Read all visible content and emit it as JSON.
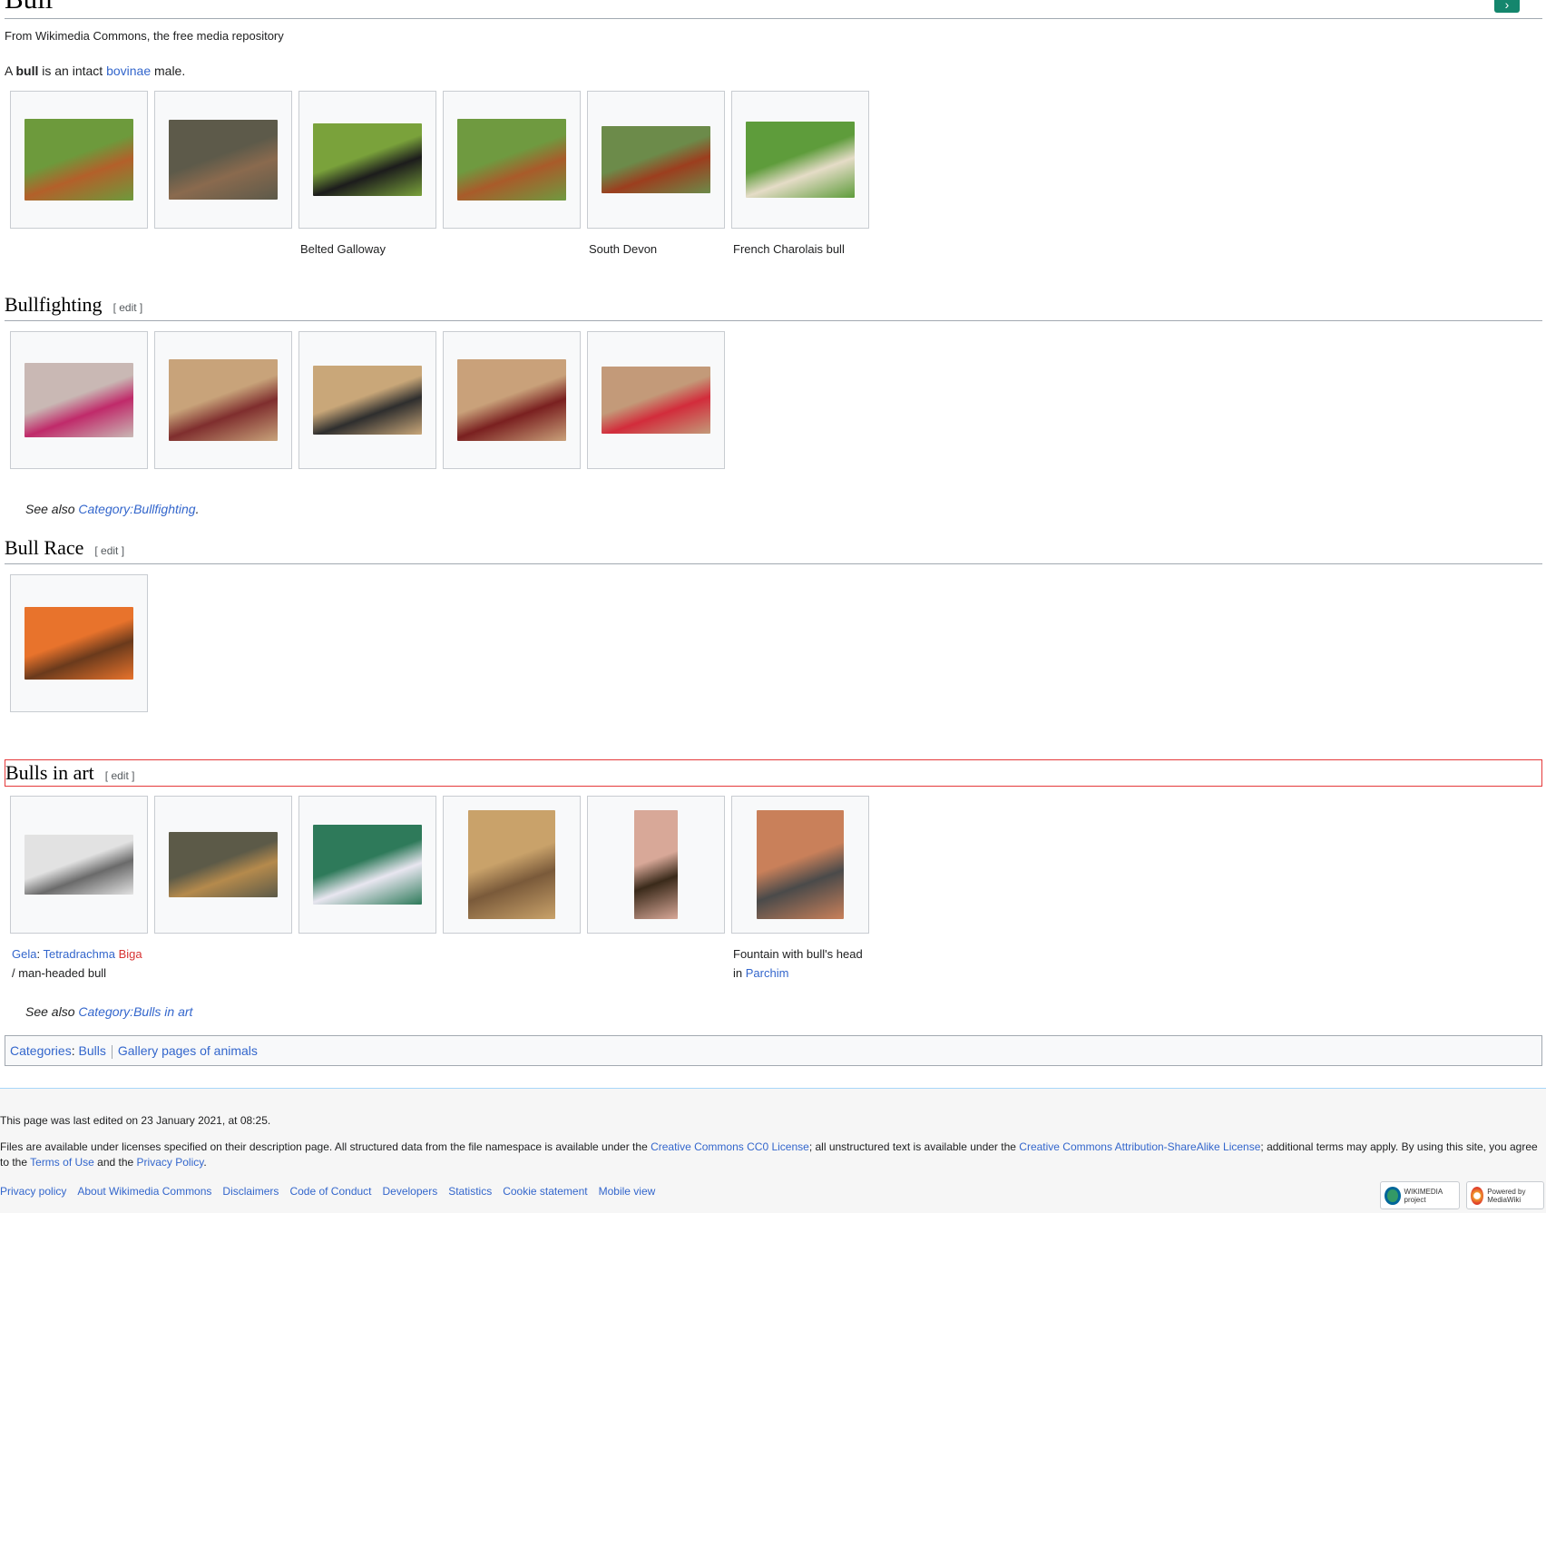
{
  "page": {
    "title": "Bull",
    "site_sub": "From Wikimedia Commons, the free media repository",
    "intro": {
      "prefix": "A ",
      "bold": "bull",
      "middle": " is an intact ",
      "link": "bovinae",
      "suffix": " male."
    }
  },
  "sections": {
    "main": {
      "images": [
        {
          "caption": "",
          "colors": [
            "#6d9a3c",
            "#b3602a"
          ]
        },
        {
          "caption": "",
          "colors": [
            "#5d5a4a",
            "#8a6a4e"
          ]
        },
        {
          "caption": "Belted Galloway",
          "colors": [
            "#7aa23b",
            "#1c1c1c"
          ]
        },
        {
          "caption": "",
          "colors": [
            "#6f9a40",
            "#a95b2a"
          ]
        },
        {
          "caption": "South Devon",
          "colors": [
            "#6c8b4a",
            "#9c3e1e"
          ]
        },
        {
          "caption": "French Charolais bull",
          "colors": [
            "#5e9c3b",
            "#e5dcc7"
          ]
        }
      ]
    },
    "bullfighting": {
      "heading": "Bullfighting",
      "edit": "[ edit ]",
      "images": [
        {
          "colors": [
            "#c9b8b4",
            "#c02a6a"
          ]
        },
        {
          "colors": [
            "#c8a37a",
            "#7f2e2e"
          ]
        },
        {
          "colors": [
            "#c9a779",
            "#2e2e2e"
          ]
        },
        {
          "colors": [
            "#c9a17a",
            "#7a2020"
          ]
        },
        {
          "colors": [
            "#c39a79",
            "#d22c3b"
          ]
        }
      ],
      "see_also_prefix": "See also ",
      "see_also_link": "Category:Bullfighting",
      "see_also_suffix": "."
    },
    "bull_race": {
      "heading": "Bull Race",
      "edit": "[ edit ]",
      "images": [
        {
          "colors": [
            "#e8732c",
            "#6a3a1c"
          ]
        }
      ]
    },
    "bulls_in_art": {
      "heading": "Bulls in art",
      "edit": "[ edit ]",
      "images": [
        {
          "colors": [
            "#e2e2e2",
            "#6a6a6a"
          ]
        },
        {
          "colors": [
            "#5c5a48",
            "#b58a4c"
          ]
        },
        {
          "colors": [
            "#2e7a5a",
            "#e8e6f0"
          ]
        },
        {
          "colors": [
            "#c9a26a",
            "#7a5a3a"
          ]
        },
        {
          "colors": [
            "#d8a898",
            "#3a2a1a"
          ]
        },
        {
          "colors": [
            "#c9805a",
            "#4a4a4a"
          ]
        }
      ],
      "caption1": {
        "link1": "Gela",
        "sep": ": ",
        "link2": "Tetradrachma",
        "space": " ",
        "redlink": "Biga",
        "line2": "/ man-headed bull"
      },
      "caption6": {
        "line1": "Fountain with bull's head",
        "prefix": "in ",
        "link": "Parchim"
      },
      "see_also_prefix": "See also ",
      "see_also_link": "Category:Bulls in art"
    }
  },
  "categories": {
    "label": "Categories",
    "items": [
      "Bulls",
      "Gallery pages of animals"
    ]
  },
  "footer": {
    "last_modified": "This page was last edited on 23 January 2021, at 08:25.",
    "license": {
      "t1": "Files are available under licenses specified on their description page. All structured data from the file namespace is available under the ",
      "l1": "Creative Commons CC0 License",
      "t2": "; all unstructured text is available under the ",
      "l2": "Creative Commons Attribution-ShareAlike License",
      "t3": "; additional terms may apply. By using this site, you agree to the ",
      "l3": "Terms of Use",
      "t4": " and the ",
      "l4": "Privacy Policy",
      "t5": "."
    },
    "links": [
      "Privacy policy",
      "About Wikimedia Commons",
      "Disclaimers",
      "Code of Conduct",
      "Developers",
      "Statistics",
      "Cookie statement",
      "Mobile view"
    ],
    "badges": {
      "wikimedia": "WIKIMEDIA project",
      "mediawiki": "Powered by MediaWiki"
    }
  }
}
